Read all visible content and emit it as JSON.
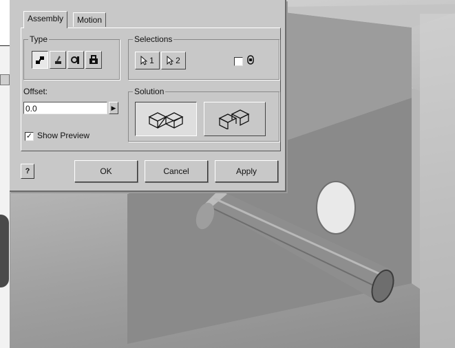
{
  "dialog": {
    "tabs": [
      {
        "label": "Assembly",
        "active": true
      },
      {
        "label": "Motion",
        "active": false
      }
    ],
    "type_group": {
      "legend": "Type",
      "buttons": [
        {
          "icon": "mate-constraint-icon",
          "pressed": true
        },
        {
          "icon": "angle-constraint-icon",
          "pressed": false
        },
        {
          "icon": "tangent-constraint-icon",
          "pressed": false
        },
        {
          "icon": "insert-constraint-icon",
          "pressed": false
        }
      ]
    },
    "selections_group": {
      "legend": "Selections",
      "select1_label": "1",
      "select2_label": "2",
      "pick_part_first_checked": false,
      "pick_part_icon": "pick-part-first-icon"
    },
    "offset": {
      "label": "Offset:",
      "value": "0.0"
    },
    "show_preview": {
      "label": "Show Preview",
      "checked": true,
      "mark": "✓"
    },
    "solution_group": {
      "legend": "Solution",
      "options": [
        {
          "name": "mate",
          "icon": "mate-solution-icon",
          "pressed": true
        },
        {
          "name": "flush",
          "icon": "flush-solution-icon",
          "pressed": false
        }
      ]
    },
    "buttons": {
      "help": "?",
      "ok": "OK",
      "cancel": "Cancel",
      "apply": "Apply"
    }
  },
  "colors": {
    "dialog_bg": "#c8c8c8",
    "plate_face": "#8a8a8a",
    "plate_edge": "#cfcfcf",
    "pin": "#8e8e8e"
  }
}
